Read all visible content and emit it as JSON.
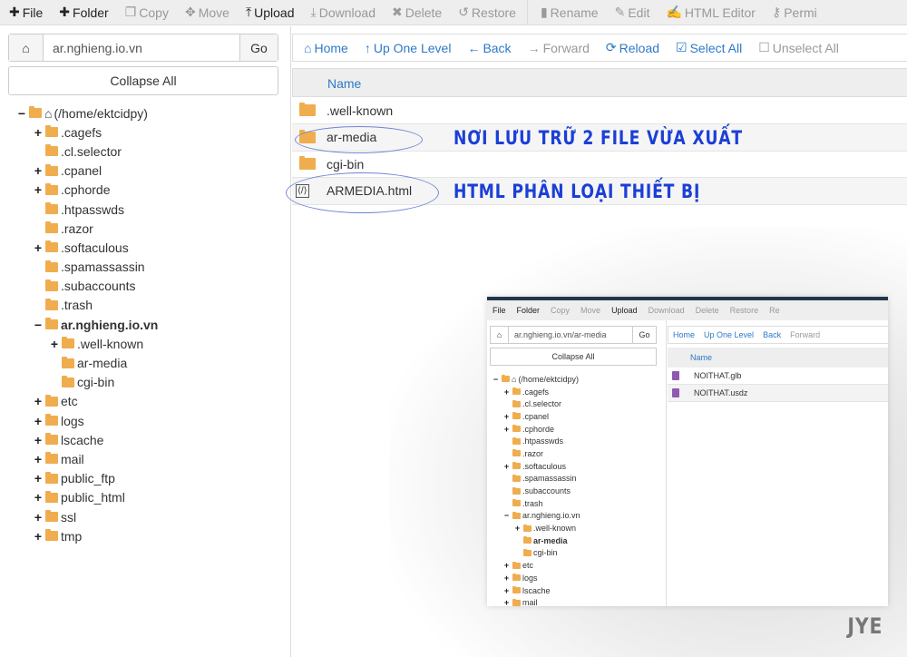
{
  "toolbar": [
    {
      "label": "File",
      "icon": "plus-icon",
      "enabled": true
    },
    {
      "label": "Folder",
      "icon": "plus-icon",
      "enabled": true
    },
    {
      "label": "Copy",
      "icon": "copy-icon",
      "enabled": false
    },
    {
      "label": "Move",
      "icon": "move-icon",
      "enabled": false
    },
    {
      "label": "Upload",
      "icon": "upload-icon",
      "enabled": true
    },
    {
      "label": "Download",
      "icon": "download-icon",
      "enabled": false
    },
    {
      "label": "Delete",
      "icon": "x-icon",
      "enabled": false
    },
    {
      "label": "Restore",
      "icon": "undo-icon",
      "enabled": false
    },
    {
      "label": "Rename",
      "icon": "file-icon",
      "enabled": false
    },
    {
      "label": "Edit",
      "icon": "pencil-icon",
      "enabled": false
    },
    {
      "label": "HTML Editor",
      "icon": "edit-icon",
      "enabled": false
    },
    {
      "label": "Permi",
      "icon": "key-icon",
      "enabled": false
    }
  ],
  "path": {
    "value": "ar.nghieng.io.vn",
    "go": "Go"
  },
  "collapse_all": "Collapse All",
  "tree": [
    {
      "label": "(/home/ektcidpy)",
      "level": 0,
      "exp": "−",
      "home": true
    },
    {
      "label": ".cagefs",
      "level": 1,
      "exp": "+"
    },
    {
      "label": ".cl.selector",
      "level": 1,
      "exp": ""
    },
    {
      "label": ".cpanel",
      "level": 1,
      "exp": "+"
    },
    {
      "label": ".cphorde",
      "level": 1,
      "exp": "+"
    },
    {
      "label": ".htpasswds",
      "level": 1,
      "exp": ""
    },
    {
      "label": ".razor",
      "level": 1,
      "exp": ""
    },
    {
      "label": ".softaculous",
      "level": 1,
      "exp": "+"
    },
    {
      "label": ".spamassassin",
      "level": 1,
      "exp": ""
    },
    {
      "label": ".subaccounts",
      "level": 1,
      "exp": ""
    },
    {
      "label": ".trash",
      "level": 1,
      "exp": ""
    },
    {
      "label": "ar.nghieng.io.vn",
      "level": 1,
      "exp": "−",
      "bold": true
    },
    {
      "label": ".well-known",
      "level": 2,
      "exp": "+"
    },
    {
      "label": "ar-media",
      "level": 2,
      "exp": ""
    },
    {
      "label": "cgi-bin",
      "level": 2,
      "exp": ""
    },
    {
      "label": "etc",
      "level": 1,
      "exp": "+"
    },
    {
      "label": "logs",
      "level": 1,
      "exp": "+"
    },
    {
      "label": "lscache",
      "level": 1,
      "exp": "+"
    },
    {
      "label": "mail",
      "level": 1,
      "exp": "+"
    },
    {
      "label": "public_ftp",
      "level": 1,
      "exp": "+"
    },
    {
      "label": "public_html",
      "level": 1,
      "exp": "+"
    },
    {
      "label": "ssl",
      "level": 1,
      "exp": "+"
    },
    {
      "label": "tmp",
      "level": 1,
      "exp": "+"
    }
  ],
  "nav": [
    {
      "label": "Home",
      "icon": "home-icon",
      "enabled": true
    },
    {
      "label": "Up One Level",
      "icon": "arrow-up-icon",
      "enabled": true
    },
    {
      "label": "Back",
      "icon": "arrow-left-icon",
      "enabled": true
    },
    {
      "label": "Forward",
      "icon": "arrow-right-icon",
      "enabled": false
    },
    {
      "label": "Reload",
      "icon": "reload-icon",
      "enabled": true
    },
    {
      "label": "Select All",
      "icon": "checkbox-checked-icon",
      "enabled": true
    },
    {
      "label": "Unselect All",
      "icon": "checkbox-icon",
      "enabled": false
    }
  ],
  "table": {
    "header": "Name",
    "rows": [
      {
        "name": ".well-known",
        "type": "folder"
      },
      {
        "name": "ar-media",
        "type": "folder"
      },
      {
        "name": "cgi-bin",
        "type": "folder"
      },
      {
        "name": "ARMEDIA.html",
        "type": "html"
      }
    ]
  },
  "annotations": {
    "note1": "NƠI LƯU TRỮ 2 FILE VỪA XUẤT",
    "note2": "HTML PHÂN LOẠI THIẾT BỊ",
    "color": "#1b3fd6"
  },
  "inset": {
    "toolbar": [
      "File",
      "Folder",
      "Copy",
      "Move",
      "Upload",
      "Download",
      "Delete",
      "Restore",
      "Re"
    ],
    "toolbar_enabled": [
      true,
      true,
      false,
      false,
      true,
      false,
      false,
      false,
      false
    ],
    "path": "ar.nghieng.io.vn/ar-media",
    "go": "Go",
    "collapse_all": "Collapse All",
    "nav": [
      "Home",
      "Up One Level",
      "Back",
      "Forward"
    ],
    "tree": [
      {
        "label": "(/home/ektcidpy)",
        "level": 0,
        "exp": "−",
        "home": true
      },
      {
        "label": ".cagefs",
        "level": 1,
        "exp": "+"
      },
      {
        "label": ".cl.selector",
        "level": 1,
        "exp": ""
      },
      {
        "label": ".cpanel",
        "level": 1,
        "exp": "+"
      },
      {
        "label": ".cphorde",
        "level": 1,
        "exp": "+"
      },
      {
        "label": ".htpasswds",
        "level": 1,
        "exp": ""
      },
      {
        "label": ".razor",
        "level": 1,
        "exp": ""
      },
      {
        "label": ".softaculous",
        "level": 1,
        "exp": "+"
      },
      {
        "label": ".spamassassin",
        "level": 1,
        "exp": ""
      },
      {
        "label": ".subaccounts",
        "level": 1,
        "exp": ""
      },
      {
        "label": ".trash",
        "level": 1,
        "exp": ""
      },
      {
        "label": "ar.nghieng.io.vn",
        "level": 1,
        "exp": "−"
      },
      {
        "label": ".well-known",
        "level": 2,
        "exp": "+"
      },
      {
        "label": "ar-media",
        "level": 2,
        "exp": "",
        "bold": true
      },
      {
        "label": "cgi-bin",
        "level": 2,
        "exp": ""
      },
      {
        "label": "etc",
        "level": 1,
        "exp": "+"
      },
      {
        "label": "logs",
        "level": 1,
        "exp": "+"
      },
      {
        "label": "lscache",
        "level": 1,
        "exp": "+"
      },
      {
        "label": "mail",
        "level": 1,
        "exp": "+"
      }
    ],
    "header": "Name",
    "files": [
      "NOITHAT.glb",
      "NOITHAT.usdz"
    ]
  },
  "watermark": "JYE"
}
